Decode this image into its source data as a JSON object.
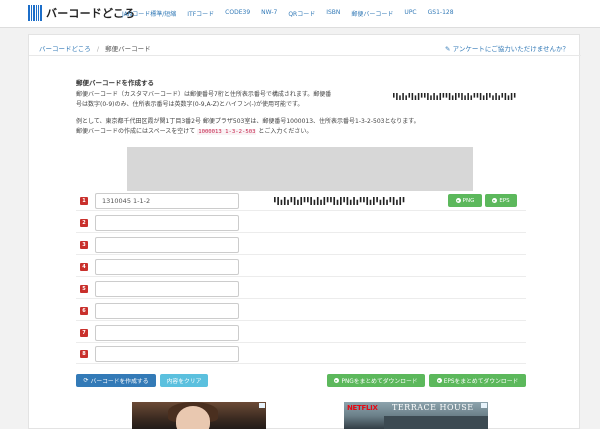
{
  "site": {
    "name": "バーコードどころ"
  },
  "nav": [
    "JANコード標準/短縮",
    "ITFコード",
    "CODE39",
    "NW-7",
    "QRコード",
    "ISBN",
    "郵便バーコード",
    "UPC",
    "GS1-128"
  ],
  "breadcrumb": {
    "home": "バーコードどころ",
    "sep": "/",
    "current": "郵便バーコード"
  },
  "survey_link": "アンケートにご協力いただけませんか？",
  "section": {
    "title": "郵便バーコードを作成する",
    "desc_1": "郵便バーコード（カスタマバーコード）は郵便番号7桁と住所表示番号で構成されます。郵便番",
    "desc_2": "号は数字(0-9)のみ、住所表示番号は英数字(0-9,A-Z)とハイフン(-)が使用可能です。",
    "example_1": "例として、東京都千代田区霞が関1丁目3番2号 郵便プラザ503室は、郵便番号1000013、住所表示番号1-3-2-503となります。",
    "example_2_pre": "郵便バーコードの作成にはスペースを空けて",
    "example_code": "1000013 1-3-2-503",
    "example_2_post": "とご入力ください。"
  },
  "rows": [
    {
      "num": "1",
      "value": "1310045 1-1-2"
    },
    {
      "num": "2",
      "value": ""
    },
    {
      "num": "3",
      "value": ""
    },
    {
      "num": "4",
      "value": ""
    },
    {
      "num": "5",
      "value": ""
    },
    {
      "num": "6",
      "value": ""
    },
    {
      "num": "7",
      "value": ""
    },
    {
      "num": "8",
      "value": ""
    }
  ],
  "row_buttons": {
    "png": "PNG",
    "eps": "EPS"
  },
  "actions": {
    "create": "バーコードを作成する",
    "clear": "内容をクリア",
    "png_all": "PNGをまとめてダウンロード",
    "eps_all": "EPSをまとめてダウンロード"
  },
  "ads": {
    "right_brand": "NETFLIX",
    "right_title": "TERRACE HOUSE"
  },
  "colors": {
    "primary": "#337ab7",
    "success": "#5cb85c",
    "info": "#5bc0de",
    "danger": "#c9302c"
  },
  "barcode_pattern": "2131321312213131221312131322131231321312"
}
